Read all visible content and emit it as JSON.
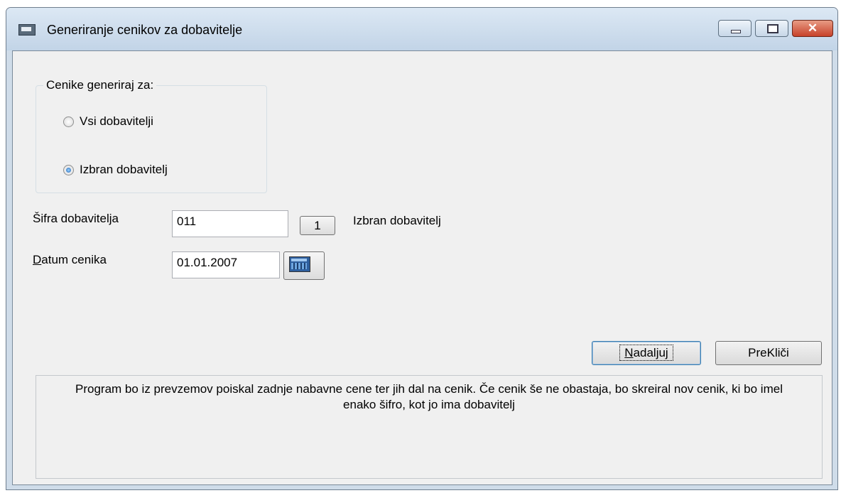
{
  "window": {
    "title": "Generiranje cenikov za dobavitelje",
    "close_glyph": "✕"
  },
  "group": {
    "legend": "Cenike generiraj za:",
    "options": [
      {
        "label": "Vsi dobavitelji",
        "checked": false
      },
      {
        "label": "Izbran dobavitelj",
        "checked": true
      }
    ]
  },
  "supplier": {
    "label": "Šifra dobavitelja",
    "value": "011",
    "lookup_label": "1",
    "name": "Izbran dobavitelj"
  },
  "date": {
    "label_access": "D",
    "label_rest": "atum cenika",
    "value": "01.01.2007"
  },
  "buttons": {
    "continue_access": "N",
    "continue_rest": "adaljuj",
    "cancel_pre": "Pre",
    "cancel_access": "K",
    "cancel_rest": "liči"
  },
  "info": {
    "text": "Program bo iz prevzemov poiskal zadnje nabavne cene ter jih dal na cenik. Če cenik še ne obastaja, bo skreiral nov cenik, ki bo imel enako šifro, kot jo ima dobavitelj"
  },
  "colors": {
    "window_frame": "#cfdce9",
    "client_bg": "#f0f0f0",
    "close_button": "#c7422a"
  }
}
